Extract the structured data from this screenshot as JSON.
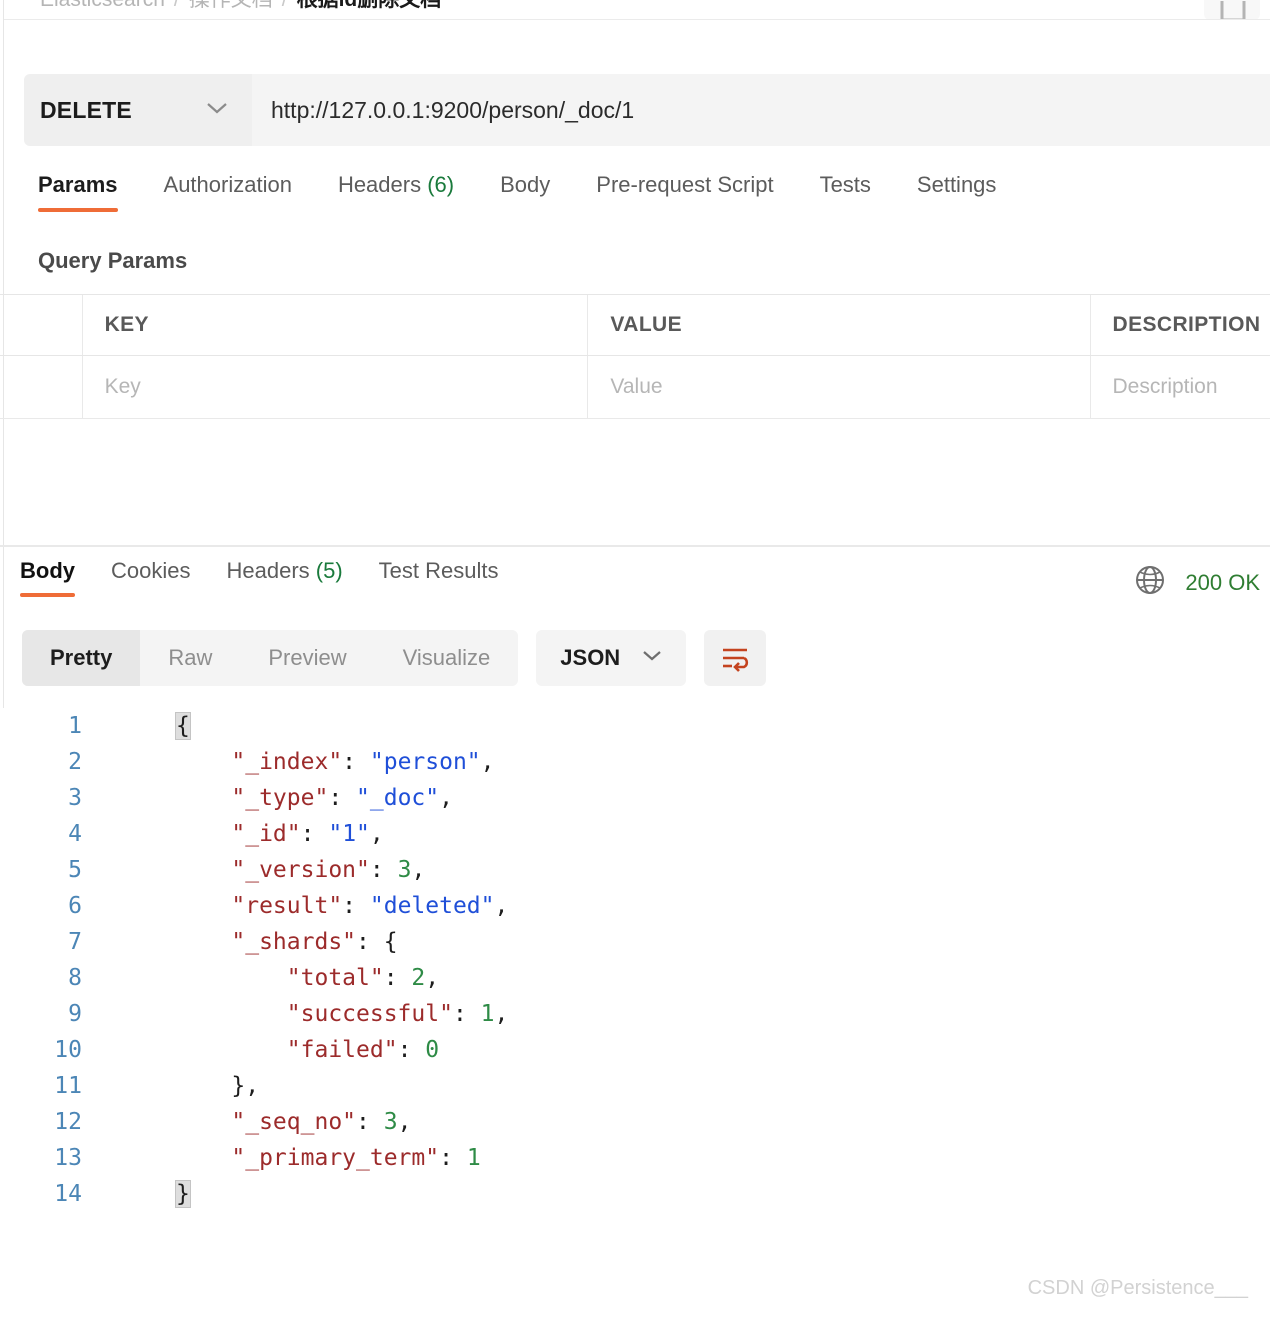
{
  "breadcrumb": {
    "root": "Elasticsearch",
    "sep": "/",
    "middle": "操作文档",
    "current": "根据id删除文档"
  },
  "request": {
    "method": "DELETE",
    "url": "http://127.0.0.1:9200/person/_doc/1",
    "tabs": [
      {
        "label": "Params",
        "count": ""
      },
      {
        "label": "Authorization",
        "count": ""
      },
      {
        "label": "Headers",
        "count": "(6)"
      },
      {
        "label": "Body",
        "count": ""
      },
      {
        "label": "Pre-request Script",
        "count": ""
      },
      {
        "label": "Tests",
        "count": ""
      },
      {
        "label": "Settings",
        "count": ""
      }
    ],
    "query_params_title": "Query Params",
    "table": {
      "headers": {
        "key": "KEY",
        "value": "VALUE",
        "description": "DESCRIPTION"
      },
      "row_placeholders": {
        "key": "Key",
        "value": "Value",
        "description": "Description"
      }
    }
  },
  "response": {
    "tabs": [
      {
        "label": "Body",
        "count": ""
      },
      {
        "label": "Cookies",
        "count": ""
      },
      {
        "label": "Headers",
        "count": "(5)"
      },
      {
        "label": "Test Results",
        "count": ""
      }
    ],
    "status": "200 OK",
    "status_color": "#2f7d32",
    "view_modes": [
      "Pretty",
      "Raw",
      "Preview",
      "Visualize"
    ],
    "format": "JSON",
    "lines": [
      {
        "no": "1",
        "guide1": false,
        "guide2": false,
        "parts": [
          {
            "t": "{",
            "c": "brace-hl"
          }
        ]
      },
      {
        "no": "2",
        "guide1": true,
        "guide2": false,
        "parts": [
          {
            "t": "    ",
            "c": "p"
          },
          {
            "t": "\"_index\"",
            "c": "k"
          },
          {
            "t": ": ",
            "c": "p"
          },
          {
            "t": "\"person\"",
            "c": "s"
          },
          {
            "t": ",",
            "c": "p"
          }
        ]
      },
      {
        "no": "3",
        "guide1": true,
        "guide2": false,
        "parts": [
          {
            "t": "    ",
            "c": "p"
          },
          {
            "t": "\"_type\"",
            "c": "k"
          },
          {
            "t": ": ",
            "c": "p"
          },
          {
            "t": "\"_doc\"",
            "c": "s"
          },
          {
            "t": ",",
            "c": "p"
          }
        ]
      },
      {
        "no": "4",
        "guide1": true,
        "guide2": false,
        "parts": [
          {
            "t": "    ",
            "c": "p"
          },
          {
            "t": "\"_id\"",
            "c": "k"
          },
          {
            "t": ": ",
            "c": "p"
          },
          {
            "t": "\"1\"",
            "c": "s"
          },
          {
            "t": ",",
            "c": "p"
          }
        ]
      },
      {
        "no": "5",
        "guide1": true,
        "guide2": false,
        "parts": [
          {
            "t": "    ",
            "c": "p"
          },
          {
            "t": "\"_version\"",
            "c": "k"
          },
          {
            "t": ": ",
            "c": "p"
          },
          {
            "t": "3",
            "c": "n"
          },
          {
            "t": ",",
            "c": "p"
          }
        ]
      },
      {
        "no": "6",
        "guide1": true,
        "guide2": false,
        "parts": [
          {
            "t": "    ",
            "c": "p"
          },
          {
            "t": "\"result\"",
            "c": "k"
          },
          {
            "t": ": ",
            "c": "p"
          },
          {
            "t": "\"deleted\"",
            "c": "s"
          },
          {
            "t": ",",
            "c": "p"
          }
        ]
      },
      {
        "no": "7",
        "guide1": true,
        "guide2": false,
        "parts": [
          {
            "t": "    ",
            "c": "p"
          },
          {
            "t": "\"_shards\"",
            "c": "k"
          },
          {
            "t": ": ",
            "c": "p"
          },
          {
            "t": "{",
            "c": "p"
          }
        ]
      },
      {
        "no": "8",
        "guide1": true,
        "guide2": true,
        "parts": [
          {
            "t": "        ",
            "c": "p"
          },
          {
            "t": "\"total\"",
            "c": "k"
          },
          {
            "t": ": ",
            "c": "p"
          },
          {
            "t": "2",
            "c": "n"
          },
          {
            "t": ",",
            "c": "p"
          }
        ]
      },
      {
        "no": "9",
        "guide1": true,
        "guide2": true,
        "parts": [
          {
            "t": "        ",
            "c": "p"
          },
          {
            "t": "\"successful\"",
            "c": "k"
          },
          {
            "t": ": ",
            "c": "p"
          },
          {
            "t": "1",
            "c": "n"
          },
          {
            "t": ",",
            "c": "p"
          }
        ]
      },
      {
        "no": "10",
        "guide1": true,
        "guide2": true,
        "parts": [
          {
            "t": "        ",
            "c": "p"
          },
          {
            "t": "\"failed\"",
            "c": "k"
          },
          {
            "t": ": ",
            "c": "p"
          },
          {
            "t": "0",
            "c": "n"
          }
        ]
      },
      {
        "no": "11",
        "guide1": true,
        "guide2": false,
        "parts": [
          {
            "t": "    ",
            "c": "p"
          },
          {
            "t": "}",
            "c": "p"
          },
          {
            "t": ",",
            "c": "p"
          }
        ]
      },
      {
        "no": "12",
        "guide1": true,
        "guide2": false,
        "parts": [
          {
            "t": "    ",
            "c": "p"
          },
          {
            "t": "\"_seq_no\"",
            "c": "k"
          },
          {
            "t": ": ",
            "c": "p"
          },
          {
            "t": "3",
            "c": "n"
          },
          {
            "t": ",",
            "c": "p"
          }
        ]
      },
      {
        "no": "13",
        "guide1": true,
        "guide2": false,
        "parts": [
          {
            "t": "    ",
            "c": "p"
          },
          {
            "t": "\"_primary_term\"",
            "c": "k"
          },
          {
            "t": ": ",
            "c": "p"
          },
          {
            "t": "1",
            "c": "n"
          }
        ]
      },
      {
        "no": "14",
        "guide1": false,
        "guide2": false,
        "parts": [
          {
            "t": "}",
            "c": "brace-hl"
          }
        ]
      }
    ]
  },
  "watermark": "CSDN @Persistence___",
  "theme": {
    "accent": "#ef6c37",
    "key_color": "#9c2b2b",
    "string_color": "#1f4fd8",
    "number_color": "#2e8b46",
    "linenumber_color": "#4c86b6"
  }
}
